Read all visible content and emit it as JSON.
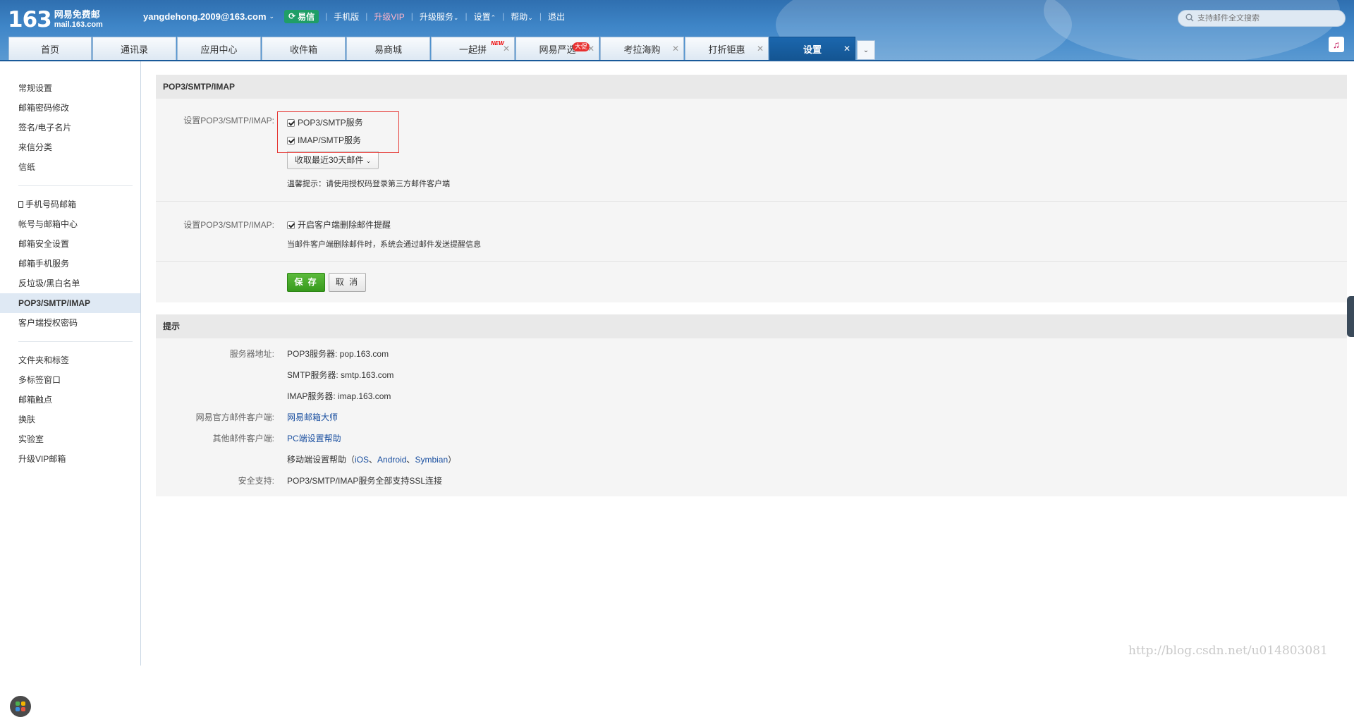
{
  "header": {
    "logo_num": "163",
    "logo_title": "网易免费邮",
    "logo_domain": "mail.163.com",
    "user_email": "yangdehong.2009@163.com",
    "yixin_label": "易信",
    "top_links": {
      "mobile": "手机版",
      "vip": "升级VIP",
      "upgrade": "升级服务",
      "settings": "设置",
      "help": "帮助",
      "logout": "退出"
    },
    "search_placeholder": "支持邮件全文搜索"
  },
  "tabs": [
    {
      "label": "首页"
    },
    {
      "label": "通讯录"
    },
    {
      "label": "应用中心"
    },
    {
      "label": "收件箱"
    },
    {
      "label": "易商城"
    },
    {
      "label": "一起拼",
      "badge": "NEW"
    },
    {
      "label": "网易严选",
      "badge": "大促"
    },
    {
      "label": "考拉海购"
    },
    {
      "label": "打折钜惠"
    },
    {
      "label": "设置"
    }
  ],
  "sidebar": {
    "group1": [
      "常规设置",
      "邮箱密码修改",
      "签名/电子名片",
      "来信分类",
      "信纸"
    ],
    "group2": [
      "手机号码邮箱",
      "帐号与邮箱中心",
      "邮箱安全设置",
      "邮箱手机服务",
      "反垃圾/黑白名单",
      "POP3/SMTP/IMAP",
      "客户端授权密码"
    ],
    "group3": [
      "文件夹和标签",
      "多标签窗口",
      "邮箱触点",
      "换肤",
      "实验室",
      "升级VIP邮箱"
    ]
  },
  "pop": {
    "title": "POP3/SMTP/IMAP",
    "label1": "设置POP3/SMTP/IMAP:",
    "opt_pop": "POP3/SMTP服务",
    "opt_imap": "IMAP/SMTP服务",
    "fetch_select": "收取最近30天邮件",
    "tip": "温馨提示：请使用授权码登录第三方邮件客户端",
    "label2": "设置POP3/SMTP/IMAP:",
    "opt_notify": "开启客户端删除邮件提醒",
    "notify_desc": "当邮件客户端删除邮件时，系统会通过邮件发送提醒信息",
    "save": "保 存",
    "cancel": "取 消"
  },
  "tips": {
    "title": "提示",
    "server_label": "服务器地址:",
    "pop3": "POP3服务器: pop.163.com",
    "smtp": "SMTP服务器: smtp.163.com",
    "imap": "IMAP服务器: imap.163.com",
    "official_label": "网易官方邮件客户端:",
    "official_link": "网易邮箱大师",
    "other_label": "其他邮件客户端:",
    "pc_link": "PC端设置帮助",
    "mobile_prefix": "移动端设置帮助（",
    "ios": "iOS",
    "android": "Android",
    "symbian": "Symbian",
    "mobile_suffix": "）",
    "security_label": "安全支持:",
    "security_text": "POP3/SMTP/IMAP服务全部支持SSL连接"
  },
  "watermark": "http://blog.csdn.net/u014803081"
}
